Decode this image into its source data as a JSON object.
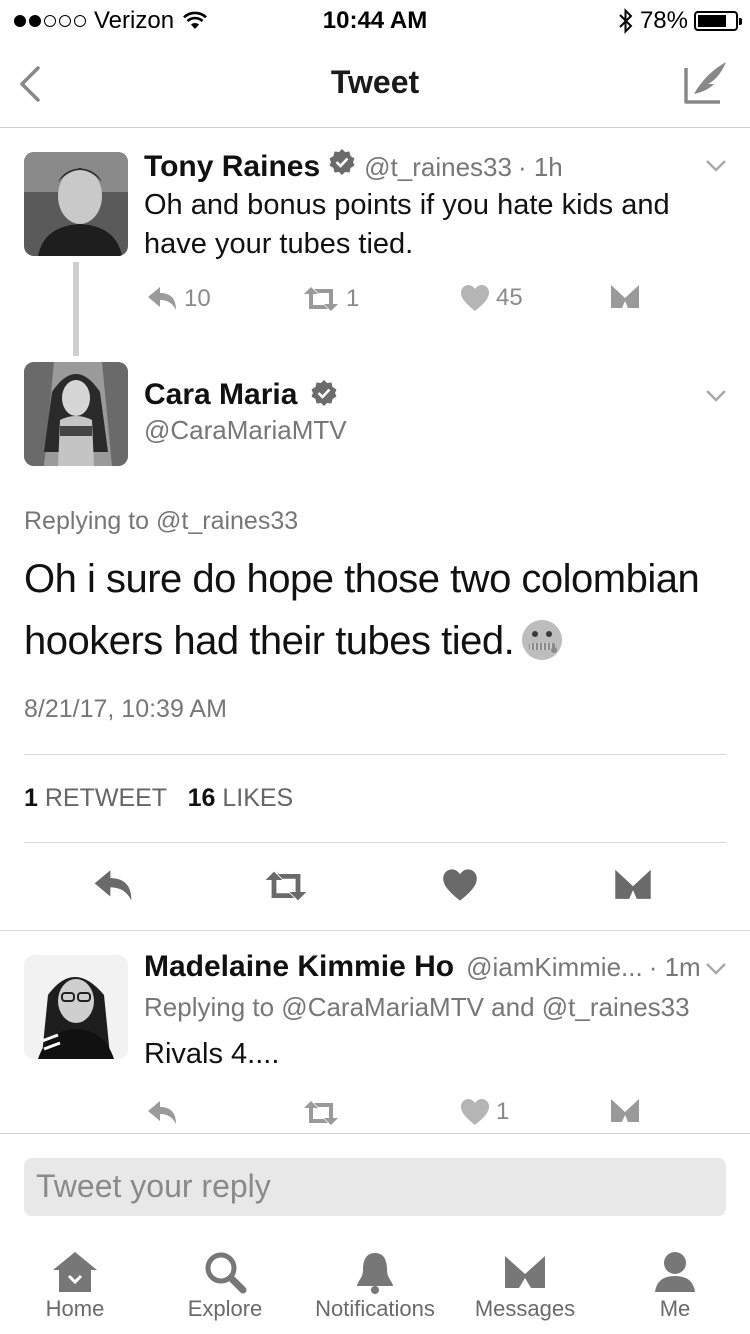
{
  "status_bar": {
    "carrier": "Verizon",
    "time": "10:44 AM",
    "battery": "78%",
    "battery_level": 0.78
  },
  "nav": {
    "title": "Tweet"
  },
  "parent_tweet": {
    "name": "Tony Raines",
    "handle": "@t_raines33",
    "age": "· 1h",
    "text": "Oh and bonus points if you hate kids and have your tubes tied.",
    "replies": "10",
    "retweets": "1",
    "likes": "45"
  },
  "main_tweet": {
    "name": "Cara Maria",
    "handle": "@CaraMariaMTV",
    "replying_to": "Replying to @t_raines33",
    "text": "Oh i sure do hope those two colombian hookers had their tubes tied.",
    "timestamp": "8/21/17, 10:39 AM",
    "retweet_count": "1",
    "retweet_label": "RETWEET",
    "like_count": "16",
    "like_label": "LIKES"
  },
  "reply_tweet": {
    "name": "Madelaine Kimmie Ho",
    "handle": "@iamKimmie...",
    "age": "· 1m",
    "replying_to": "Replying to @CaraMariaMTV and @t_raines33",
    "text": "Rivals 4....",
    "likes": "1"
  },
  "composer": {
    "placeholder": "Tweet your reply"
  },
  "tabs": [
    {
      "label": "Home",
      "icon": "home-icon"
    },
    {
      "label": "Explore",
      "icon": "search-icon"
    },
    {
      "label": "Notifications",
      "icon": "bell-icon"
    },
    {
      "label": "Messages",
      "icon": "envelope-icon"
    },
    {
      "label": "Me",
      "icon": "person-icon"
    }
  ]
}
